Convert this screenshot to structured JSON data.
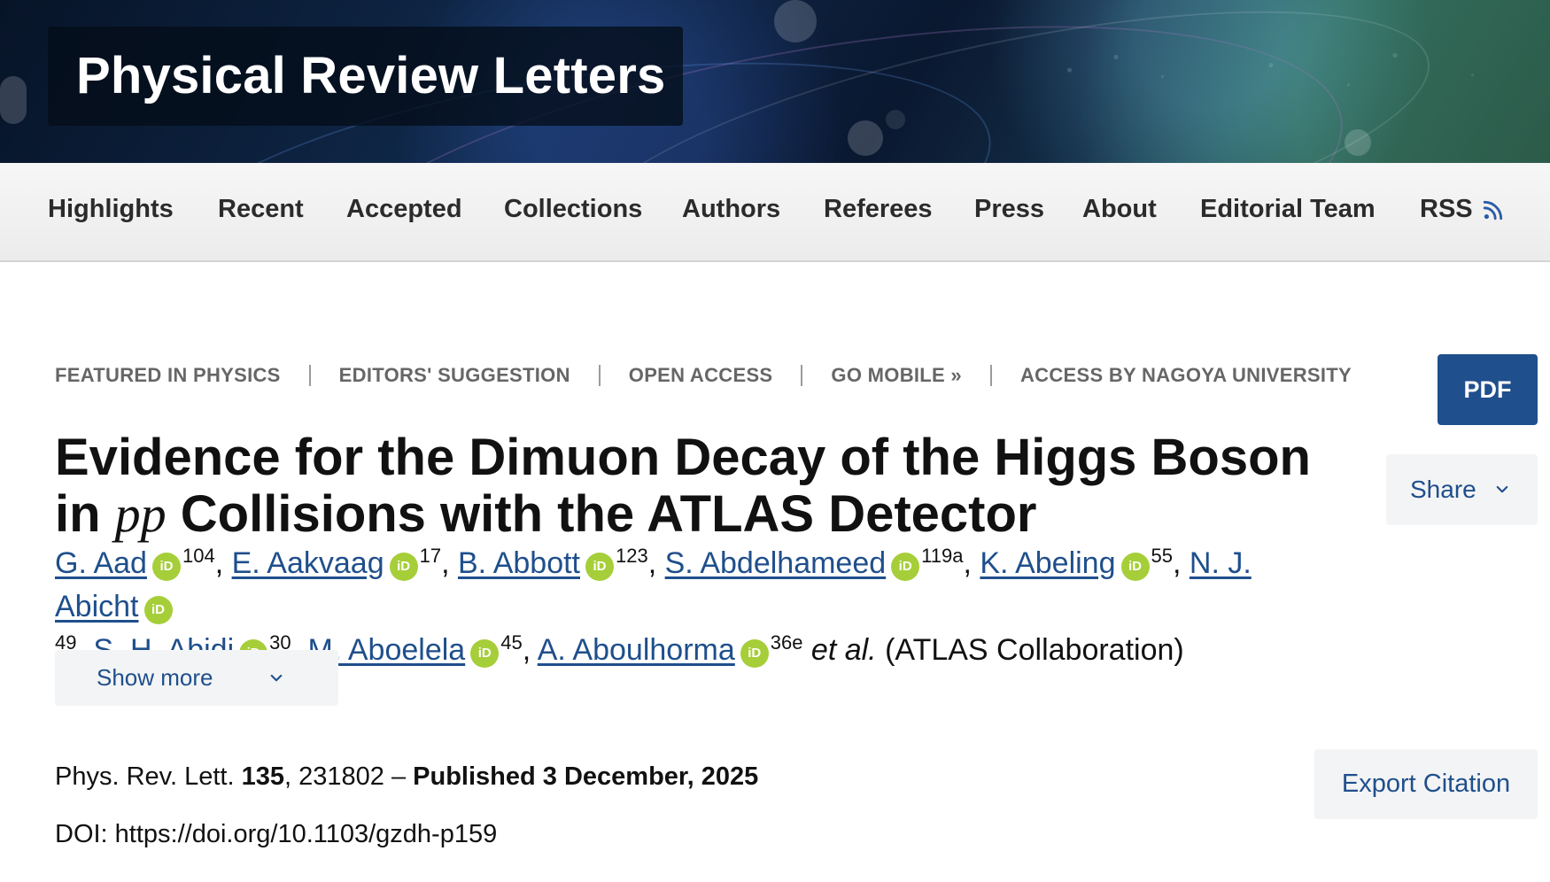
{
  "header": {
    "journal_title": "Physical Review Letters"
  },
  "nav": {
    "items": [
      {
        "label": "Highlights"
      },
      {
        "label": "Recent"
      },
      {
        "label": "Accepted"
      },
      {
        "label": "Collections"
      },
      {
        "label": "Authors"
      },
      {
        "label": "Referees"
      },
      {
        "label": "Press"
      },
      {
        "label": "About"
      },
      {
        "label": "Editorial Team"
      },
      {
        "label": "RSS"
      }
    ],
    "rss_icon": "rss-icon"
  },
  "article": {
    "badges": [
      "FEATURED IN PHYSICS",
      "EDITORS' SUGGESTION",
      "OPEN ACCESS",
      "GO MOBILE »",
      "ACCESS BY NAGOYA UNIVERSITY"
    ],
    "title_line1": "Evidence for the Dimuon Decay of the Higgs Boson",
    "title_line2_prefix": "in ",
    "title_math": "pp",
    "title_line2_suffix": " Collisions with the ATLAS Detector",
    "authors": [
      {
        "name": "G. Aad",
        "sup": "104"
      },
      {
        "name": "E. Aakvaag",
        "sup": "17"
      },
      {
        "name": "B. Abbott",
        "sup": "123"
      },
      {
        "name": "S. Abdelhameed",
        "sup": "119a"
      },
      {
        "name": "K. Abeling",
        "sup": "55"
      },
      {
        "name": "N. J. Abicht",
        "sup": "49"
      },
      {
        "name": "S. H. Abidi",
        "sup": "30"
      },
      {
        "name": "M. Aboelela",
        "sup": "45"
      },
      {
        "name": "A. Aboulhorma",
        "sup": "36e"
      }
    ],
    "et_al": "et al.",
    "collaboration": "(ATLAS Collaboration)",
    "show_more": "Show more",
    "citation_prefix": "Phys. Rev. Lett.",
    "volume": "135",
    "citation_mid": ", 231802 –",
    "published": "Published 3 December, 2025",
    "doi": "DOI: https://doi.org/10.1103/gzdh-p159"
  },
  "actions": {
    "pdf": "PDF",
    "share": "Share",
    "export_citation": "Export Citation"
  },
  "icons": {
    "orcid": "orcid-icon",
    "chevron_down": "chevron-down-icon"
  },
  "colors": {
    "brand_blue": "#1f4f8c",
    "orcid_green": "#a6ce39",
    "nav_text": "#2b2b2b",
    "meta_gray": "#666666",
    "button_bg": "#f3f4f5"
  }
}
